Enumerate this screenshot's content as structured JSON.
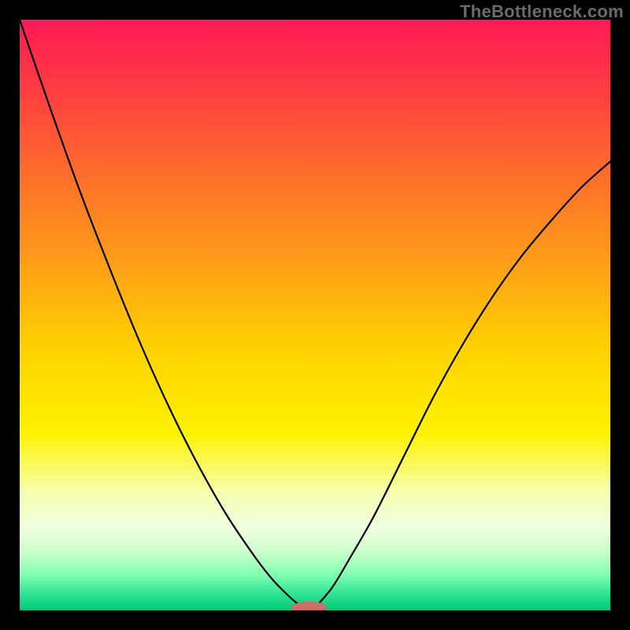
{
  "watermark": "TheBottleneck.com",
  "chart_data": {
    "type": "line",
    "title": "",
    "xlabel": "",
    "ylabel": "",
    "xlim": [
      0,
      1
    ],
    "ylim": [
      0,
      1
    ],
    "background_gradient": {
      "stops": [
        {
          "offset": 0.0,
          "color": "#ff1a56"
        },
        {
          "offset": 0.12,
          "color": "#ff3d41"
        },
        {
          "offset": 0.25,
          "color": "#ff6a2d"
        },
        {
          "offset": 0.4,
          "color": "#ff9a1a"
        },
        {
          "offset": 0.55,
          "color": "#ffd000"
        },
        {
          "offset": 0.7,
          "color": "#fff200"
        },
        {
          "offset": 0.8,
          "color": "#f6ffb0"
        },
        {
          "offset": 0.86,
          "color": "#f0ffe0"
        },
        {
          "offset": 0.9,
          "color": "#ccffcc"
        },
        {
          "offset": 0.94,
          "color": "#80ffb0"
        },
        {
          "offset": 0.97,
          "color": "#33e695"
        },
        {
          "offset": 1.0,
          "color": "#00c878"
        }
      ]
    },
    "series": [
      {
        "name": "left-curve",
        "x": [
          0.0,
          0.05,
          0.1,
          0.15,
          0.2,
          0.25,
          0.3,
          0.35,
          0.4,
          0.43,
          0.46,
          0.475
        ],
        "y": [
          1.0,
          0.855,
          0.715,
          0.585,
          0.462,
          0.35,
          0.25,
          0.162,
          0.088,
          0.05,
          0.02,
          0.008
        ]
      },
      {
        "name": "right-curve",
        "x": [
          0.505,
          0.53,
          0.56,
          0.6,
          0.65,
          0.7,
          0.75,
          0.8,
          0.85,
          0.9,
          0.95,
          1.0
        ],
        "y": [
          0.01,
          0.04,
          0.09,
          0.16,
          0.26,
          0.36,
          0.45,
          0.53,
          0.6,
          0.66,
          0.715,
          0.76
        ]
      }
    ],
    "marker": {
      "name": "bottom-marker",
      "cx": 0.49,
      "cy": 0.005,
      "rx": 0.03,
      "ry": 0.01,
      "fill": "#cf6f6a"
    }
  }
}
